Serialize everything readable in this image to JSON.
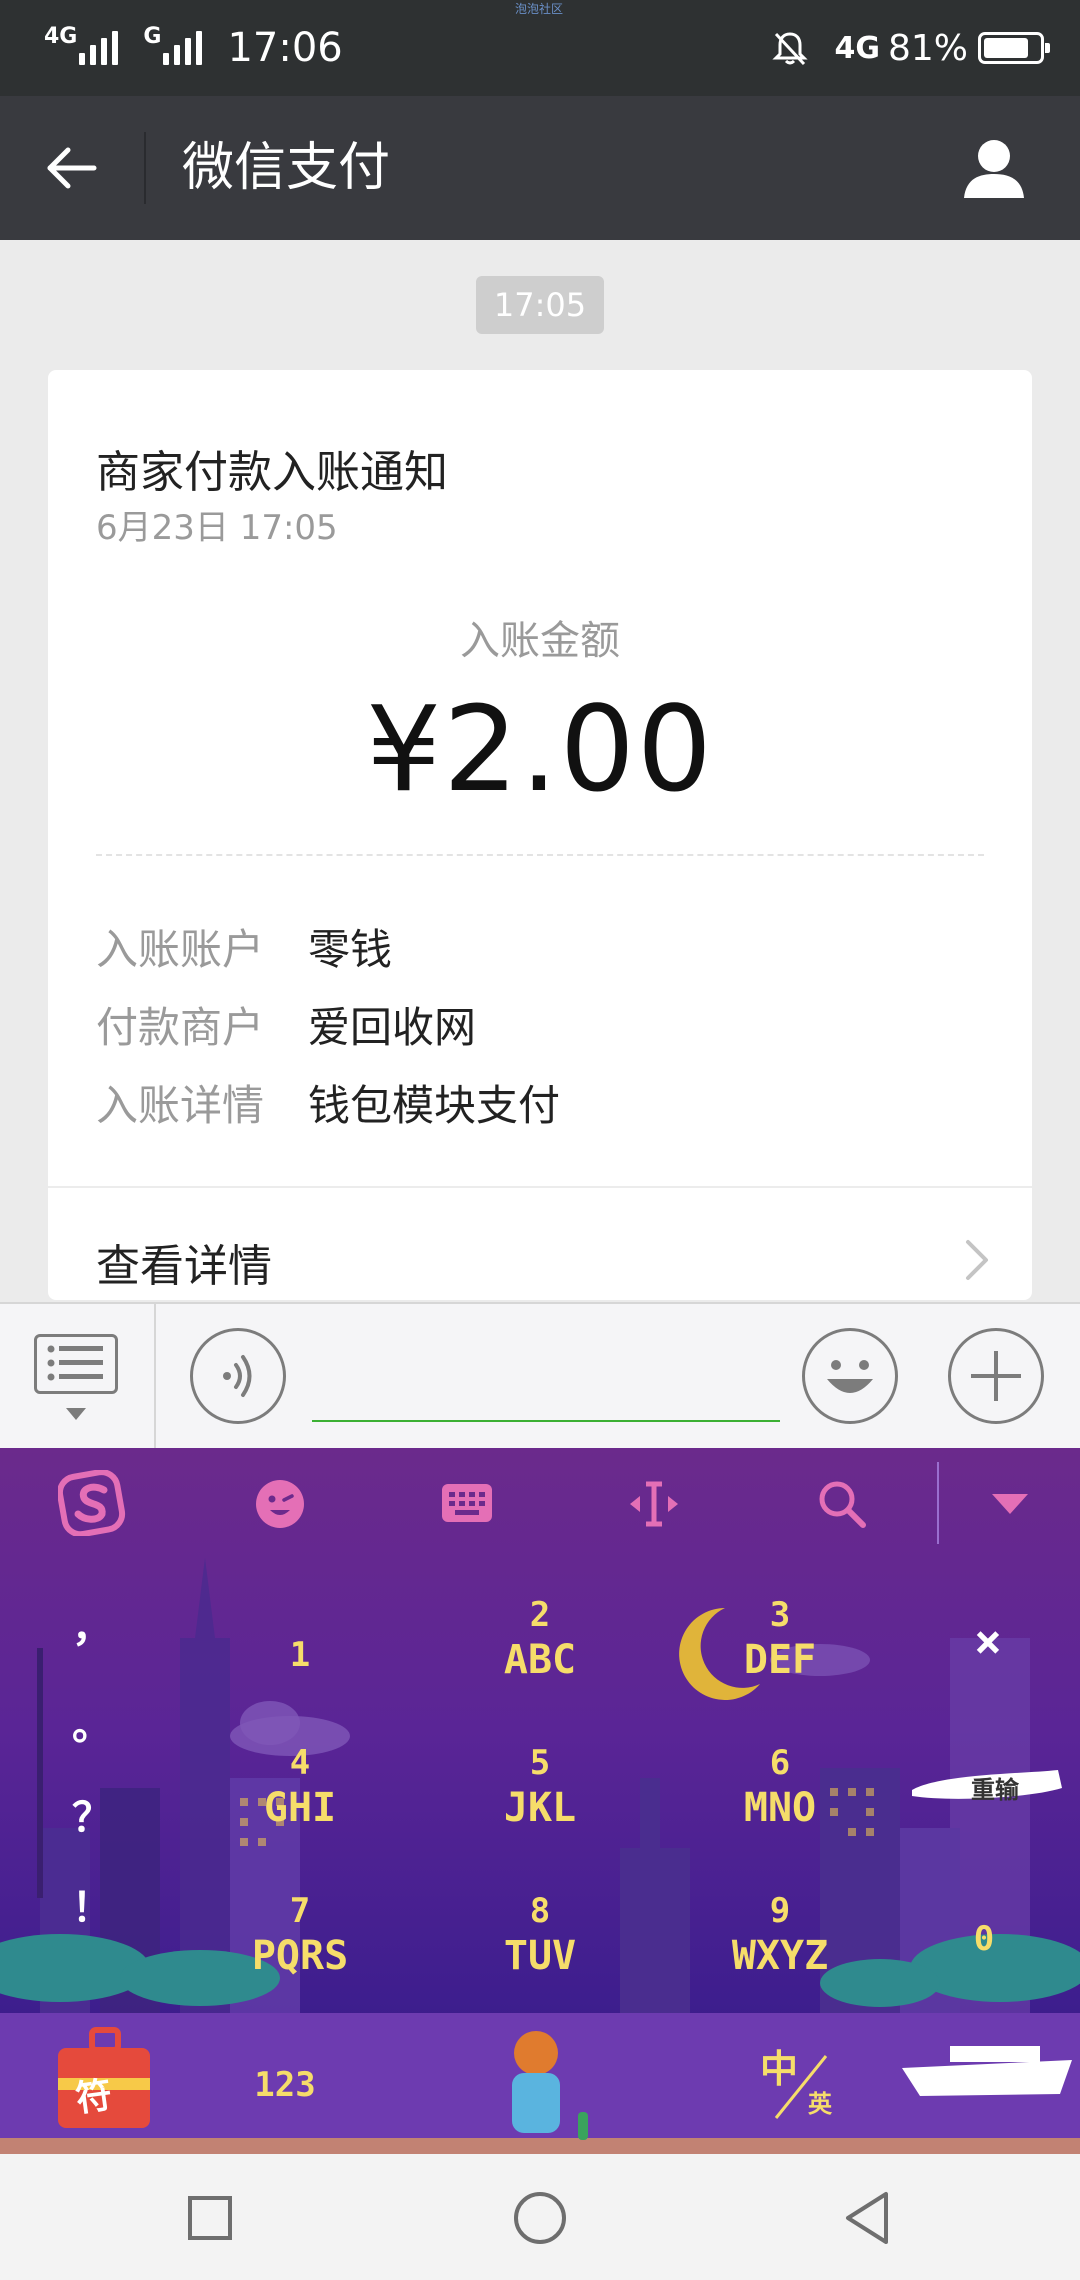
{
  "status_bar": {
    "net1": "4G",
    "net2": "G",
    "time": "17:06",
    "tiny_label": "泡泡社区",
    "net_right": "4G",
    "battery": "81%",
    "battery_level": 0.81
  },
  "header": {
    "title": "微信支付"
  },
  "chat": {
    "timestamp": "17:05"
  },
  "card": {
    "title": "商家付款入账通知",
    "date": "6月23日  17:05",
    "amount_label": "入账金额",
    "amount": "¥2.00",
    "rows": [
      {
        "key": "入账账户",
        "value": "零钱"
      },
      {
        "key": "付款商户",
        "value": "爱回收网"
      },
      {
        "key": "入账详情",
        "value": "钱包模块支付"
      }
    ],
    "view_details": "查看详情"
  },
  "keyboard": {
    "punct": [
      "，",
      "。",
      "？",
      "！"
    ],
    "keys": [
      {
        "num": "1",
        "letters": ""
      },
      {
        "num": "2",
        "letters": "ABC"
      },
      {
        "num": "3",
        "letters": "DEF"
      },
      {
        "num": "4",
        "letters": "GHI"
      },
      {
        "num": "5",
        "letters": "JKL"
      },
      {
        "num": "6",
        "letters": "MNO"
      },
      {
        "num": "7",
        "letters": "PQRS"
      },
      {
        "num": "8",
        "letters": "TUV"
      },
      {
        "num": "9",
        "letters": "WXYZ"
      }
    ],
    "zero": "0",
    "delete": "×",
    "sym": "符",
    "num_switch": "123",
    "lang_zh": "中",
    "lang_en": "英",
    "enter_label": "重输"
  }
}
